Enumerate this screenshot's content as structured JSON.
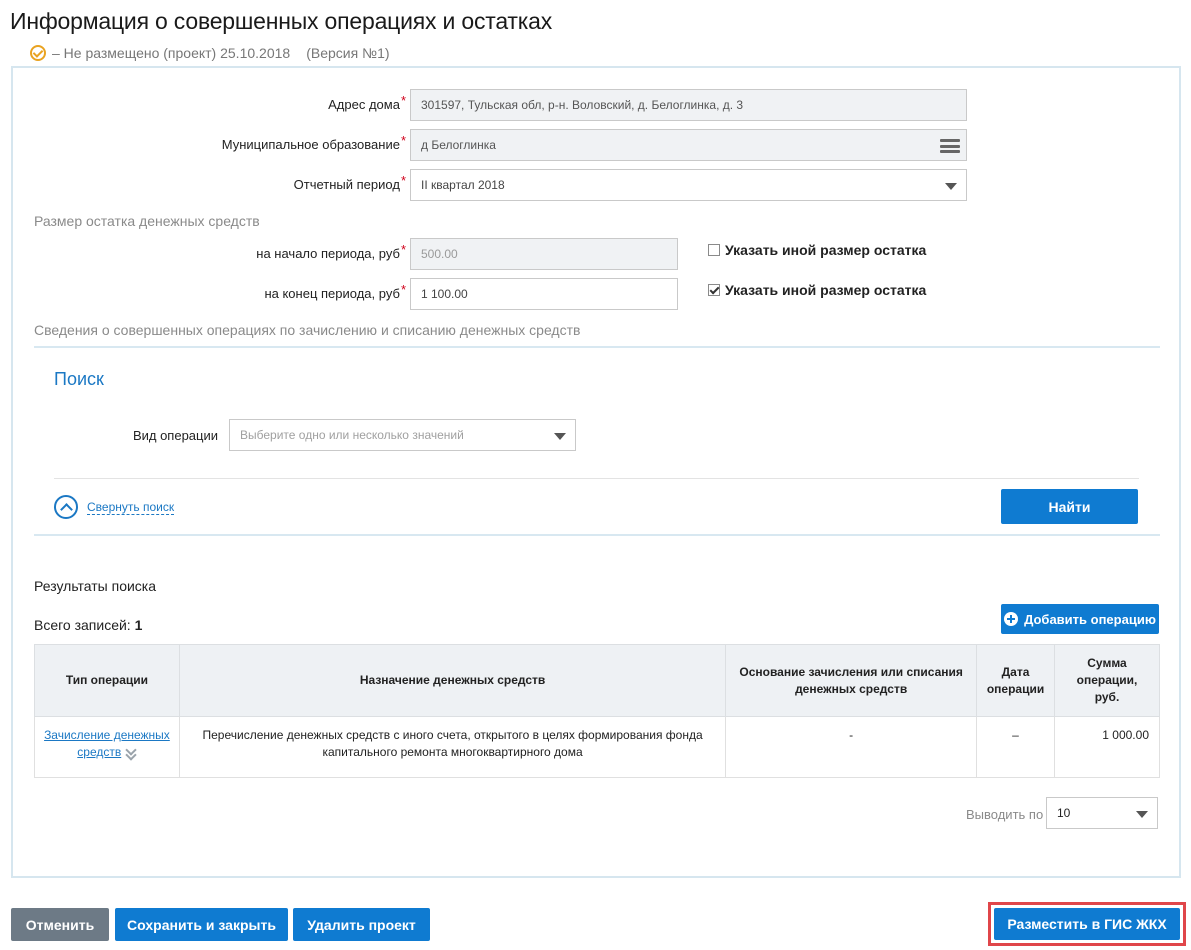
{
  "page": {
    "title": "Информация о совершенных операциях и остатках",
    "status": "–  Не размещено (проект) 25.10.2018",
    "version": "(Версия №1)"
  },
  "form": {
    "address": {
      "label": "Адрес дома",
      "value": "301597, Тульская обл, р-н. Воловский, д. Белоглинка, д. 3"
    },
    "municipality": {
      "label": "Муниципальное образование",
      "value": "д Белоглинка"
    },
    "period": {
      "label": "Отчетный период",
      "value": "II квартал 2018"
    },
    "balance_heading": "Размер остатка денежных средств",
    "start_balance": {
      "label": "на начало периода, руб",
      "value": "500.00",
      "checkbox_label": "Указать иной размер остатка",
      "checked": false
    },
    "end_balance": {
      "label": "на конец периода, руб",
      "value": "1 100.00",
      "checkbox_label": "Указать иной размер остатка",
      "checked": true
    },
    "operations_heading": "Сведения о совершенных операциях по зачислению и списанию денежных средств"
  },
  "search": {
    "title": "Поиск",
    "op_type_label": "Вид операции",
    "op_type_placeholder": "Выберите одно или несколько значений",
    "collapse_label": "Свернуть поиск",
    "find_label": "Найти"
  },
  "results": {
    "title": "Результаты поиска",
    "total_label": "Всего записей:",
    "total_value": "1",
    "add_label": "Добавить операцию",
    "columns": [
      "Тип операции",
      "Назначение денежных средств",
      "Основание зачисления или списания денежных средств",
      "Дата операции",
      "Сумма операции, руб."
    ],
    "rows": [
      {
        "type": "Зачисление денежных средств",
        "purpose": "Перечисление денежных средств с иного счета, открытого в целях формирования фонда капитального ремонта многоквартирного дома",
        "basis": "-",
        "date": "–",
        "amount": "1 000.00"
      }
    ],
    "per_page_label": "Выводить по",
    "per_page_value": "10"
  },
  "footer": {
    "cancel": "Отменить",
    "save_close": "Сохранить и закрыть",
    "delete": "Удалить проект",
    "publish": "Разместить в ГИС ЖКХ"
  },
  "colors": {
    "accent": "#0f7bd1",
    "link": "#1b78c4",
    "required": "#d0021b",
    "highlight": "#e0464a",
    "status_icon": "#e9a321"
  }
}
